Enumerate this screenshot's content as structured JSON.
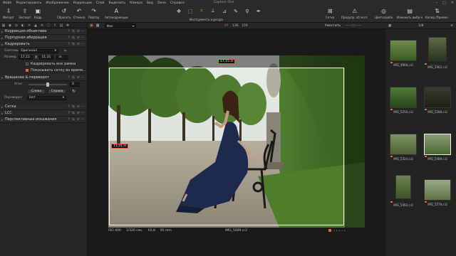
{
  "app": {
    "title": "Capture One"
  },
  "menu": [
    "Файл",
    "Редактировать",
    "Изображение",
    "Коррекции",
    "Слой",
    "Выделить",
    "Камера",
    "Вид",
    "Окно",
    "Справка"
  ],
  "toolbar": {
    "left": [
      {
        "label": "Импорт",
        "icon": "import-icon"
      },
      {
        "label": "Экспорт",
        "icon": "export-icon"
      },
      {
        "label": "Кадр",
        "icon": "camera-icon"
      },
      {
        "label": "Сбросить",
        "icon": "reset-icon"
      },
      {
        "label": "Отмена",
        "icon": "undo-icon"
      },
      {
        "label": "Повтор",
        "icon": "redo-icon"
      },
      {
        "label": "Автокоррекции",
        "icon": "auto-adjust-icon"
      }
    ],
    "cursor_tools_label": "Инструменты курсора",
    "right": [
      {
        "label": "Сетка",
        "icon": "grid-icon"
      },
      {
        "label": "Предупр. об эксп.",
        "icon": "exposure-warning-icon"
      },
      {
        "label": "Цветопроба",
        "icon": "proof-icon"
      },
      {
        "label": "Изменить выбр-е",
        "icon": "edit-selected-icon"
      },
      {
        "label": "Копир./Примен.",
        "icon": "copy-apply-icon"
      }
    ]
  },
  "left_panel": {
    "sections": {
      "lens": "Коррекция объектива",
      "purple": "Пурпурная аберрация",
      "crop": "Кадрировать",
      "rotation": "Вращение & переворот",
      "grid": "Сетка",
      "lcc": "LCC",
      "perspective": "Перспективные искажения"
    },
    "crop": {
      "ratio_label": "Соотношен.",
      "ratio_value": "Оригинал",
      "size_label": "Размер",
      "width": "17,15",
      "x": "X",
      "height": "11,31",
      "unit": "in",
      "crop_outside": "Кадрировать вне рамки",
      "show_grid": "Показывать сетку во время..."
    },
    "rotation": {
      "angle_label": "Угол",
      "angle_value": "0",
      "angle_fraction": 0.5,
      "left_button": "Слева",
      "right_button": "Справа",
      "flip_label": "Переворот",
      "flip_value": "Нет"
    }
  },
  "viewer": {
    "style_value": "Фон",
    "stats": {
      "a": "97",
      "b": "136",
      "c": "109"
    },
    "fit_label": "Уместить",
    "width_label": "17,15 in",
    "height_label": "11,31 in",
    "meta": {
      "iso": "ISO 400",
      "shutter": "1/320 сек.",
      "aperture": "f/2,8",
      "focal": "95 mm"
    },
    "filename": "IMG_5489.cr2"
  },
  "browser": {
    "counter": "1/8",
    "thumbs": [
      {
        "name": "IMG_4966.cr2"
      },
      {
        "name": "IMG_5062.cr2"
      },
      {
        "name": "IMG_5250.cr2"
      },
      {
        "name": "IMG_5288.cr2"
      },
      {
        "name": "IMG_5324.cr2"
      },
      {
        "name": "IMG_5489.cr2"
      },
      {
        "name": "IMG_5492.cr2"
      },
      {
        "name": "IMG_5578.cr2"
      }
    ]
  },
  "colors": {
    "accent": "#e8613a",
    "panel": "#262626",
    "viewer": "#1a1a1a"
  }
}
